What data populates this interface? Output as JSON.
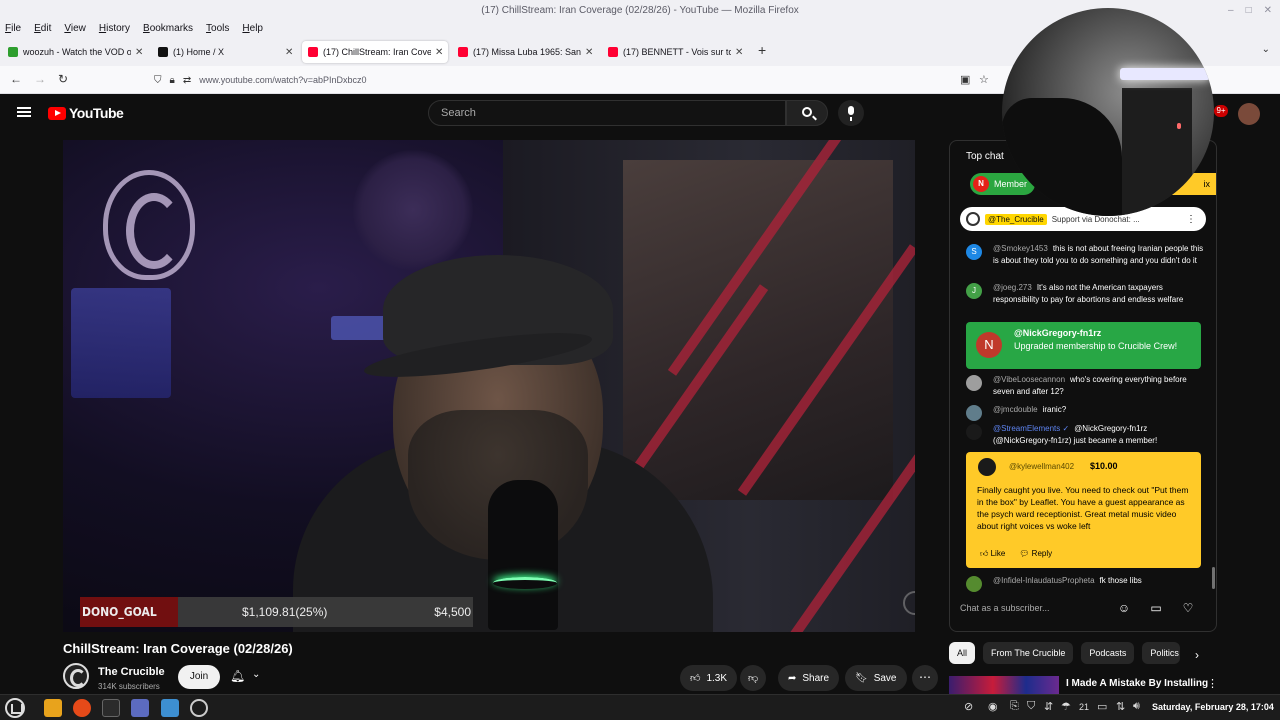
{
  "window": {
    "title": "(17) ChillStream: Iran Coverage (02/28/26) - YouTube — Mozilla Firefox",
    "controls": [
      "–",
      "□",
      "✕"
    ]
  },
  "menubar": [
    "File",
    "Edit",
    "View",
    "History",
    "Bookmarks",
    "Tools",
    "Help"
  ],
  "tabs": [
    {
      "title": "woozuh - Watch the VOD on",
      "favicon_color": "#2e9e2e",
      "active": false
    },
    {
      "title": "(1) Home / X",
      "favicon_color": "#111111",
      "active": false
    },
    {
      "title": "(17) ChillStream: Iran Cover",
      "favicon_color": "#ff0033",
      "active": true
    },
    {
      "title": "(17) Missa Luba 1965: Sanct",
      "favicon_color": "#ff0033",
      "active": false
    },
    {
      "title": "(17) BENNETT - Vois sur ton",
      "favicon_color": "#ff0033",
      "active": false
    }
  ],
  "newtab_label": "+",
  "address": {
    "url": "www.youtube.com/watch?v=abPInDxbcz0"
  },
  "youtube": {
    "logo": "YouTube",
    "search_placeholder": "Search",
    "notification_count": "9+",
    "video": {
      "title": "ChillStream: Iran Coverage (02/28/26)",
      "donation": {
        "label": "DONO_GOAL",
        "amount": "$1,109.81(25%)",
        "goal": "$4,500",
        "progress": 0.25
      }
    },
    "channel": {
      "name": "The Crucible",
      "subscribers": "314K subscribers",
      "join": "Join"
    },
    "actions": {
      "likes": "1.3K",
      "share": "Share",
      "save": "Save"
    },
    "chat": {
      "header": "Top chat",
      "member_chip": "Member",
      "member_chip_initial": "N",
      "yellow_chip": "ix",
      "pinned": {
        "author": "@The_Crucible",
        "text": "Support via Donochat: ..."
      },
      "messages": [
        {
          "initial": "S",
          "color": "#1e88e5",
          "author": "@Smokey1453",
          "text": "this is not about freeing Iranian people this is about they told you to do something and you didn't do it"
        },
        {
          "initial": "J",
          "color": "#43a047",
          "author": "@joeg.273",
          "text": "It's also not the American taxpayers responsibility to pay for abortions and endless welfare"
        },
        {
          "initial": "",
          "color": "#9e9e9e",
          "author": "@VibeLoosecannon",
          "text": "who's covering everything before seven and after 12?"
        },
        {
          "initial": "",
          "color": "#607d8b",
          "author": "@jmcdouble",
          "text": "iranic?"
        },
        {
          "initial": "",
          "color": "#1a1a1a",
          "author": "@StreamElements ✓",
          "text": "@NickGregory-fn1rz (@NickGregory-fn1rz) just became a member!"
        },
        {
          "initial": "",
          "color": "#558b2f",
          "author": "@Infidel-InlaudatusPropheta",
          "text": "fk those libs"
        }
      ],
      "membership": {
        "initial": "N",
        "author": "@NickGregory-fn1rz",
        "text": "Upgraded membership to Crucible Crew!"
      },
      "superchat": {
        "author": "@kylewellman402",
        "amount": "$10.00",
        "text": "Finally caught you live. You need to check out \"Put them in the box\" by Leaflet. You have a guest appearance as the psych ward receptionist. Great metal music video about right voices vs woke left",
        "like": "Like",
        "reply": "Reply"
      },
      "input_placeholder": "Chat as a subscriber..."
    },
    "related_chips": [
      "All",
      "From The Crucible",
      "Podcasts",
      "Politics"
    ],
    "related_video_title": "I Made A Mistake By Installing"
  },
  "taskbar": {
    "tray_count": "21",
    "clock": "Saturday, February 28, 17:04"
  }
}
